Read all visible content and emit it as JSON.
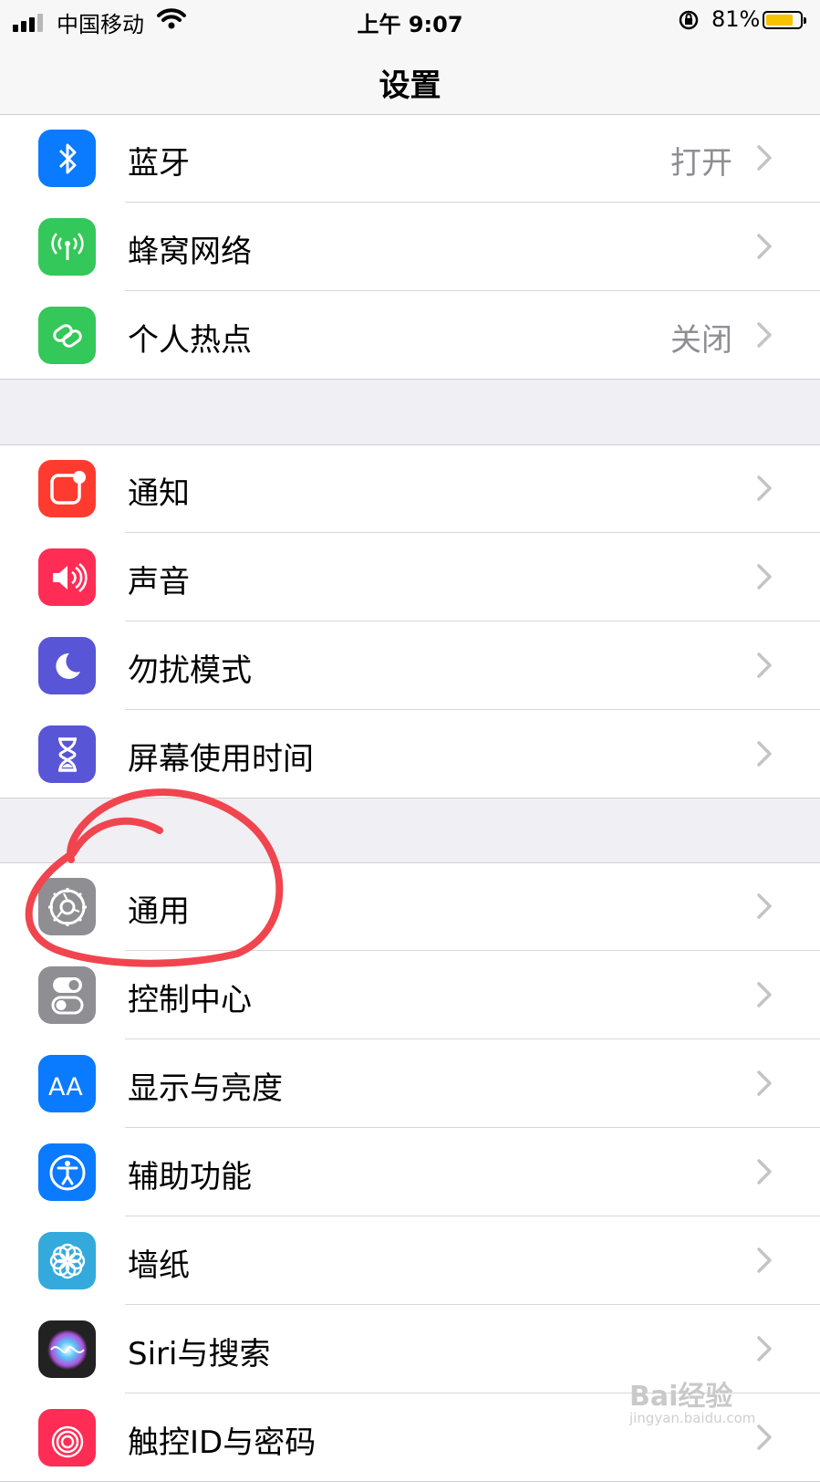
{
  "status": {
    "carrier": "中国移动",
    "time": "上午 9:07",
    "battery_pct": "81%",
    "battery_level": 0.81,
    "signal_bars": 3
  },
  "nav": {
    "title": "设置"
  },
  "group1": [
    {
      "label": "蓝牙",
      "value": "打开",
      "icon": "bluetooth-icon",
      "color": "#0a7aff"
    },
    {
      "label": "蜂窝网络",
      "value": "",
      "icon": "cellular-icon",
      "color": "#34c759"
    },
    {
      "label": "个人热点",
      "value": "关闭",
      "icon": "hotspot-icon",
      "color": "#34c759"
    }
  ],
  "group2": [
    {
      "label": "通知",
      "value": "",
      "icon": "notifications-icon",
      "color": "#ff3b30"
    },
    {
      "label": "声音",
      "value": "",
      "icon": "sound-icon",
      "color": "#ff2d55"
    },
    {
      "label": "勿扰模式",
      "value": "",
      "icon": "moon-icon",
      "color": "#5856d6"
    },
    {
      "label": "屏幕使用时间",
      "value": "",
      "icon": "hourglass-icon",
      "color": "#5856d6"
    }
  ],
  "group3": [
    {
      "label": "通用",
      "value": "",
      "icon": "gear-icon",
      "color": "#8e8e93"
    },
    {
      "label": "控制中心",
      "value": "",
      "icon": "toggles-icon",
      "color": "#8e8e93"
    },
    {
      "label": "显示与亮度",
      "value": "",
      "icon": "display-icon",
      "color": "#0a7aff"
    },
    {
      "label": "辅助功能",
      "value": "",
      "icon": "accessibility-icon",
      "color": "#0a7aff"
    },
    {
      "label": "墙纸",
      "value": "",
      "icon": "wallpaper-icon",
      "color": "#34aadc"
    },
    {
      "label": "Siri与搜索",
      "value": "",
      "icon": "siri-icon",
      "color": "#222"
    },
    {
      "label": "触控ID与密码",
      "value": "",
      "icon": "fingerprint-icon",
      "color": "#ff2d55"
    }
  ],
  "watermark": {
    "brand": "Bai经验",
    "url": "jingyan.baidu.com"
  }
}
